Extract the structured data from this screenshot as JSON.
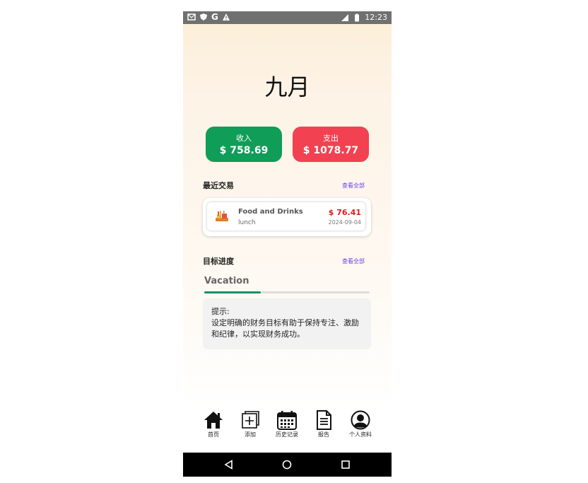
{
  "status_bar": {
    "time": "12:23",
    "left_icons": [
      "gmail-icon",
      "shield-icon",
      "google-icon",
      "warning-icon"
    ],
    "right_icons": [
      "signal-icon",
      "battery-icon"
    ]
  },
  "header": {
    "month": "九月"
  },
  "summary": {
    "income": {
      "label": "收入",
      "amount": "$ 758.69",
      "color": "#0f9d58"
    },
    "expense": {
      "label": "支出",
      "amount": "$ 1078.77",
      "color": "#f24150"
    }
  },
  "recent": {
    "title": "最近交易",
    "see_all": "查看全部",
    "transactions": [
      {
        "category": "Food and Drinks",
        "note": "lunch",
        "amount": "$ 76.41",
        "date": "2024-09-04",
        "icon": "food-icon"
      }
    ]
  },
  "goals": {
    "title": "目标进度",
    "see_all": "查看全部",
    "items": [
      {
        "name": "Vacation",
        "progress": 0.34
      }
    ]
  },
  "tip": {
    "title": "提示:",
    "body": "设定明确的财务目标有助于保持专注、激励和纪律，以实现财务成功。"
  },
  "nav": [
    {
      "label": "首页",
      "icon": "home-icon"
    },
    {
      "label": "添加",
      "icon": "add-icon"
    },
    {
      "label": "历史记录",
      "icon": "calendar-icon"
    },
    {
      "label": "报告",
      "icon": "report-icon"
    },
    {
      "label": "个人资料",
      "icon": "profile-icon"
    }
  ],
  "system_nav": [
    "back-icon",
    "home-circle-icon",
    "recents-icon"
  ]
}
